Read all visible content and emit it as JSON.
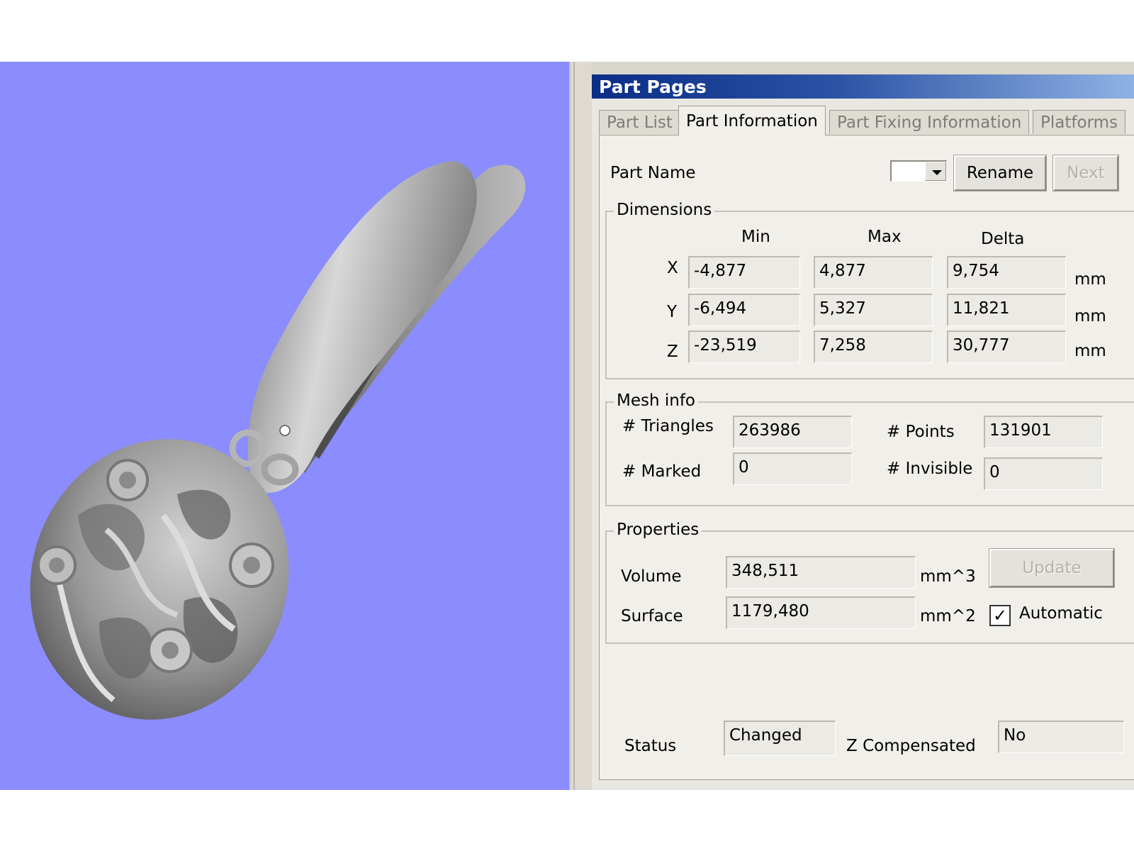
{
  "panel": {
    "title": "Part Pages",
    "tabs": [
      "Part List",
      "Part Information",
      "Part Fixing Information",
      "Platforms"
    ],
    "active_tab": "Part Information"
  },
  "part_name": {
    "label": "Part Name",
    "value": "",
    "rename_label": "Rename",
    "next_label": "Next"
  },
  "dimensions": {
    "legend": "Dimensions",
    "col_min": "Min",
    "col_max": "Max",
    "col_delta": "Delta",
    "unit": "mm",
    "rows": [
      {
        "axis": "X",
        "min": "-4,877",
        "max": "4,877",
        "delta": "9,754"
      },
      {
        "axis": "Y",
        "min": "-6,494",
        "max": "5,327",
        "delta": "11,821"
      },
      {
        "axis": "Z",
        "min": "-23,519",
        "max": "7,258",
        "delta": "30,777"
      }
    ]
  },
  "mesh": {
    "legend": "Mesh info",
    "triangles_label": "# Triangles",
    "triangles": "263986",
    "points_label": "# Points",
    "points": "131901",
    "marked_label": "# Marked",
    "marked": "0",
    "invisible_label": "# Invisible",
    "invisible": "0"
  },
  "properties": {
    "legend": "Properties",
    "volume_label": "Volume",
    "volume": "348,511",
    "volume_unit": "mm^3",
    "surface_label": "Surface",
    "surface": "1179,480",
    "surface_unit": "mm^2",
    "update_label": "Update",
    "automatic_label": "Automatic",
    "automatic_checked": true
  },
  "status": {
    "label": "Status",
    "value": "Changed",
    "zcomp_label": "Z Compensated",
    "zcomp_value": "No"
  },
  "colors": {
    "viewport_bg": "#8b8cfd",
    "model_gray": "#9e9e9e",
    "title_gradient_start": "#0a2d86",
    "title_gradient_end": "#8fb2e4"
  }
}
